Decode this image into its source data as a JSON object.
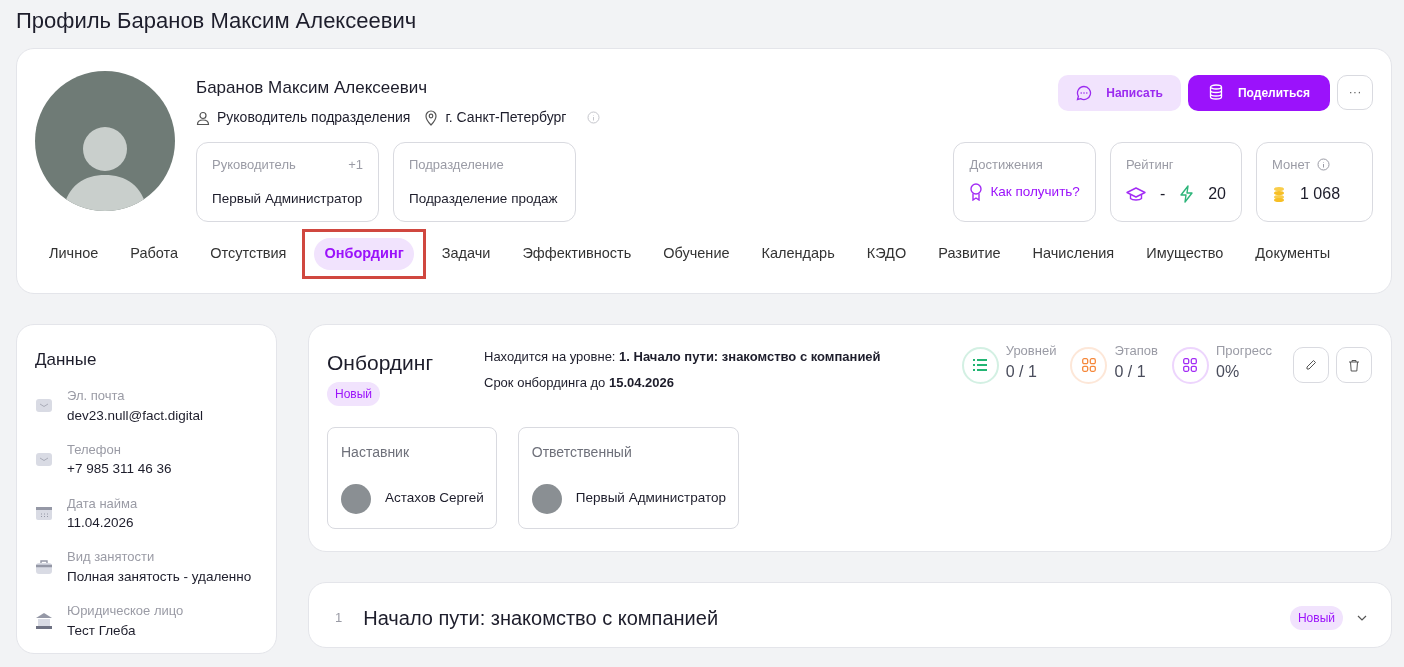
{
  "page_title": "Профиль Баранов Максим Алексеевич",
  "profile": {
    "name": "Баранов Максим Алексеевич",
    "position": "Руководитель подразделения",
    "city": "г. Санкт-Петербург",
    "actions": [
      {
        "kind": "soft",
        "label": "Написать"
      },
      {
        "kind": "primary",
        "label": "Поделиться"
      },
      {
        "kind": "more",
        "label": "···"
      }
    ],
    "info_cards": [
      {
        "label": "Руководитель",
        "extra": "+1",
        "value": "Первый Администратор"
      },
      {
        "label": "Подразделение",
        "value": "Подразделение продаж"
      }
    ],
    "stat_cards": [
      {
        "kind": "achievements",
        "label": "Достижения",
        "link": "Как получить?"
      },
      {
        "kind": "rating",
        "label": "Рейтинг",
        "rank": "-",
        "points": "20"
      },
      {
        "kind": "coins",
        "label": "Монет",
        "value": "1 068"
      }
    ]
  },
  "tabs": [
    {
      "label": "Личное",
      "selected": false
    },
    {
      "label": "Работа",
      "selected": false
    },
    {
      "label": "Отсутствия",
      "selected": false
    },
    {
      "label": "Онбординг",
      "selected": true,
      "highlighted": true
    },
    {
      "label": "Задачи",
      "selected": false
    },
    {
      "label": "Эффективность",
      "selected": false
    },
    {
      "label": "Обучение",
      "selected": false
    },
    {
      "label": "Календарь",
      "selected": false
    },
    {
      "label": "КЭДО",
      "selected": false
    },
    {
      "label": "Развитие",
      "selected": false
    },
    {
      "label": "Начисления",
      "selected": false
    },
    {
      "label": "Имущество",
      "selected": false
    },
    {
      "label": "Документы",
      "selected": false
    }
  ],
  "sidebar": {
    "title": "Данные",
    "items": [
      {
        "kind": "mail",
        "label": "Эл. почта",
        "value": "dev23.null@fact.digital"
      },
      {
        "kind": "mail",
        "label": "Телефон",
        "value": "+7 985 311 46 36"
      },
      {
        "kind": "calendar",
        "label": "Дата найма",
        "value": "11.04.2026"
      },
      {
        "kind": "briefcase",
        "label": "Вид занятости",
        "value": "Полная занятость - удаленно"
      },
      {
        "kind": "bank",
        "label": "Юридическое лицо",
        "value": "Тест Глеба"
      }
    ]
  },
  "onboarding": {
    "title": "Онбординг",
    "status": "Новый",
    "level_text": "Находится на уровне: **1. Начало пути: знакомство с компанией**",
    "deadline_text": "Срок онбординга до **15.04.2026**",
    "stats": [
      {
        "kind": "list",
        "label": "Уровней",
        "value": "0 / 1",
        "color": "#22b573"
      },
      {
        "kind": "grid",
        "label": "Этапов",
        "value": "0 / 1",
        "color": "#f5883b"
      },
      {
        "kind": "grid",
        "label": "Прогресс",
        "value": "0%",
        "color": "#a32cf5"
      }
    ],
    "people": [
      {
        "role": "Наставник",
        "name": "Астахов Сергей"
      },
      {
        "role": "Ответственный",
        "name": "Первый Администратор"
      }
    ]
  },
  "levels": [
    {
      "number": "1",
      "title": "Начало пути: знакомство с компанией",
      "status": "Новый"
    }
  ]
}
